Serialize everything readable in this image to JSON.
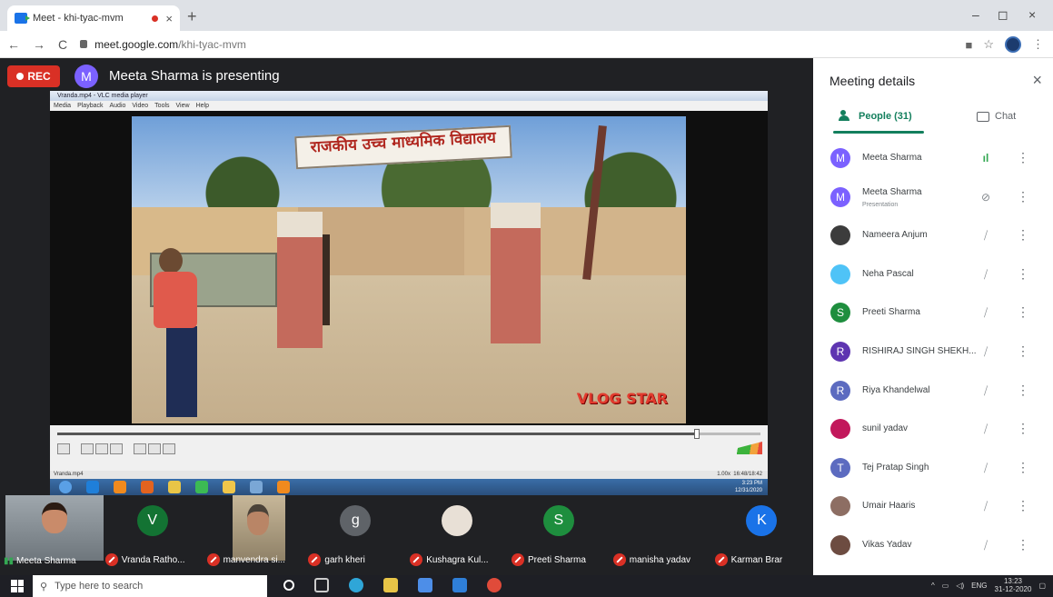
{
  "browser": {
    "tab_title": "Meet - khi-tyac-mvm",
    "tab_close": "×",
    "new_tab": "+",
    "url_host": "meet.google.com",
    "url_path": "/khi-tyac-mvm",
    "win_min": "–",
    "win_max": "◻",
    "win_close": "×",
    "back": "←",
    "forward": "→",
    "reload": "C"
  },
  "meet": {
    "rec_label": "REC",
    "presenter_initial": "M",
    "presenting_text": "Meeta Sharma is presenting"
  },
  "shared_screen": {
    "vlc_title": "Vranda.mp4 - VLC media player",
    "vlc_menu": [
      "Media",
      "Playback",
      "Audio",
      "Video",
      "Tools",
      "View",
      "Help"
    ],
    "sign_text": "राजकीय उच्च माध्यमिक विद्यालय",
    "watermark": "VLOG STAR",
    "playback_progress": 0.91,
    "status_file": "Vranda.mp4",
    "status_speed": "1.00x",
    "status_time": "16:48/18:42",
    "clock_time": "3:23 PM",
    "clock_date": "12/31/2020"
  },
  "tiles": [
    {
      "initial": "",
      "name": "Meeta Sharma",
      "muted": false,
      "color": ""
    },
    {
      "initial": "V",
      "name": "Vranda Ratho...",
      "muted": true,
      "color": "#137333"
    },
    {
      "initial": "",
      "name": "manvendra si...",
      "muted": true,
      "color": ""
    },
    {
      "initial": "g",
      "name": "garh kheri",
      "muted": true,
      "color": "#5f6368"
    },
    {
      "initial": "",
      "name": "Kushagra Kul...",
      "muted": true,
      "color": ""
    },
    {
      "initial": "S",
      "name": "Preeti Sharma",
      "muted": true,
      "color": "#1e8e3e"
    },
    {
      "initial": "",
      "name": "manisha yadav",
      "muted": true,
      "color": ""
    },
    {
      "initial": "K",
      "name": "Karman Brar",
      "muted": true,
      "color": "#1a73e8"
    }
  ],
  "panel": {
    "title": "Meeting details",
    "close": "×",
    "tab_people": "People (31)",
    "tab_chat": "Chat",
    "people": [
      {
        "initial": "M",
        "name": "Meeta Sharma",
        "sub": "",
        "color": "#7b61ff",
        "active": true
      },
      {
        "initial": "M",
        "name": "Meeta Sharma",
        "sub": "Presentation",
        "color": "#7b61ff",
        "active": false
      },
      {
        "initial": "",
        "name": "Nameera Anjum",
        "sub": "",
        "color": "#3c3c3c",
        "active": false
      },
      {
        "initial": "",
        "name": "Neha Pascal",
        "sub": "",
        "color": "#4fc3f7",
        "active": false
      },
      {
        "initial": "S",
        "name": "Preeti Sharma",
        "sub": "",
        "color": "#1e8e3e",
        "active": false
      },
      {
        "initial": "R",
        "name": "RISHIRAJ SINGH SHEKH...",
        "sub": "",
        "color": "#5e35b1",
        "active": false
      },
      {
        "initial": "R",
        "name": "Riya Khandelwal",
        "sub": "",
        "color": "#5c6bc0",
        "active": false
      },
      {
        "initial": "",
        "name": "sunil yadav",
        "sub": "",
        "color": "#c2185b",
        "active": false
      },
      {
        "initial": "T",
        "name": "Tej Pratap Singh",
        "sub": "",
        "color": "#5c6bc0",
        "active": false
      },
      {
        "initial": "",
        "name": "Umair Haaris",
        "sub": "",
        "color": "#8d6e63",
        "active": false
      },
      {
        "initial": "",
        "name": "Vikas Yadav",
        "sub": "",
        "color": "#6d4c41",
        "active": false
      }
    ]
  },
  "taskbar": {
    "search_placeholder": "Type here to search",
    "lang": "ENG",
    "time": "13:23",
    "date": "31-12-2020"
  }
}
